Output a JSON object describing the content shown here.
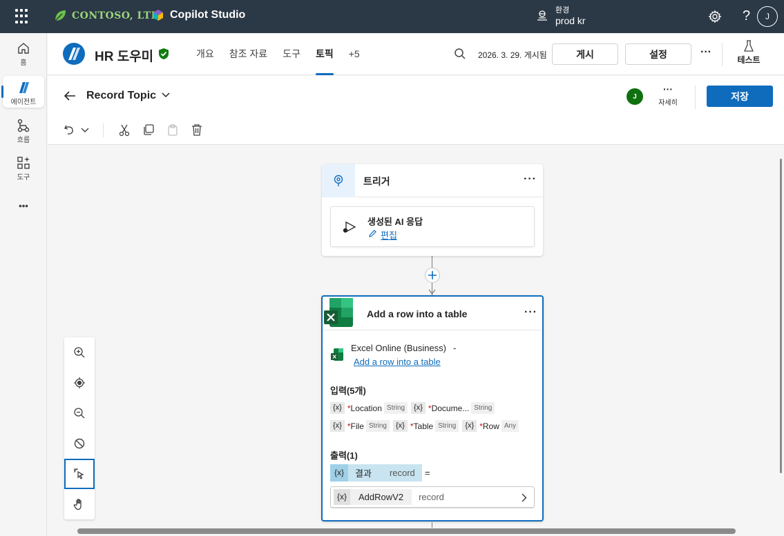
{
  "topbar": {
    "logo_text": "CONTOSO, LTD.",
    "product_name": "Copilot Studio",
    "env_label": "환경",
    "env_value": "prod kr",
    "help": "?",
    "user_initial": "J"
  },
  "leftnav": {
    "items": [
      {
        "label": "홈",
        "icon": "home-icon"
      },
      {
        "label": "에이전트",
        "icon": "agent-icon"
      },
      {
        "label": "흐름",
        "icon": "flow-icon"
      },
      {
        "label": "도구",
        "icon": "tools-icon"
      }
    ],
    "more": "•••"
  },
  "agent": {
    "name": "HR 도우미",
    "tabs": [
      "개요",
      "참조 자료",
      "도구",
      "토픽",
      "+5"
    ],
    "active_tab": "토픽",
    "published_info": "2026. 3. 29. 게시됨",
    "publish_label": "게시",
    "settings_label": "설정",
    "more": "···",
    "test_label": "테스트"
  },
  "topic": {
    "title": "Record Topic",
    "user_initial": "J",
    "details_label": "자세히",
    "details_icon": "···",
    "save_label": "저장"
  },
  "trigger_card": {
    "title": "트리거",
    "more": "···",
    "content_title": "생성된 AI 응답",
    "edit_label": "편집"
  },
  "action_card": {
    "title": "Add a row into a table",
    "more": "···",
    "connector": "Excel Online (Business)",
    "connector_sep": "-",
    "action_link": "Add a row into a table",
    "inputs_label": "입력(5개)",
    "inputs": [
      {
        "x": "{x}",
        "name": "Location",
        "type": "String"
      },
      {
        "x": "{x}",
        "name": "Docume...",
        "type": "String"
      },
      {
        "x": "{x}",
        "name": "File",
        "type": "String"
      },
      {
        "x": "{x}",
        "name": "Table",
        "type": "String"
      },
      {
        "x": "{x}",
        "name": "Row",
        "type": "Any"
      }
    ],
    "required_mark": "*",
    "outputs_label": "출력(1)",
    "output_var": {
      "x": "{x}",
      "name": "결과",
      "type": "record"
    },
    "equals": "=",
    "output_value": {
      "x": "{x}",
      "name": "AddRowV2",
      "type": "record"
    }
  },
  "colors": {
    "topbar": "#2b3846",
    "accent": "#0f6cbd",
    "excel_green": "#107c41",
    "shield_green": "#107c10",
    "avatar_green": "#0e700e"
  }
}
